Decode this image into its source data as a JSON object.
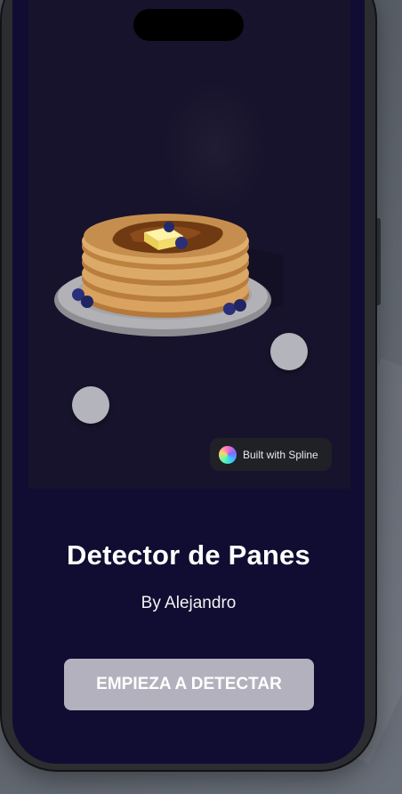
{
  "app": {
    "title": "Detector de Panes",
    "subtitle": "By Alejandro",
    "cta_label": "EMPIEZA A DETECTAR"
  },
  "scene": {
    "badge_label": "Built with Spline",
    "badge_icon": "spline-logo-icon",
    "illustration": "pancake-stack"
  },
  "colors": {
    "screen_background": "#110c31",
    "scene_background": "#17132c",
    "button_background": "#b3b1bd",
    "text": "#ffffff"
  }
}
